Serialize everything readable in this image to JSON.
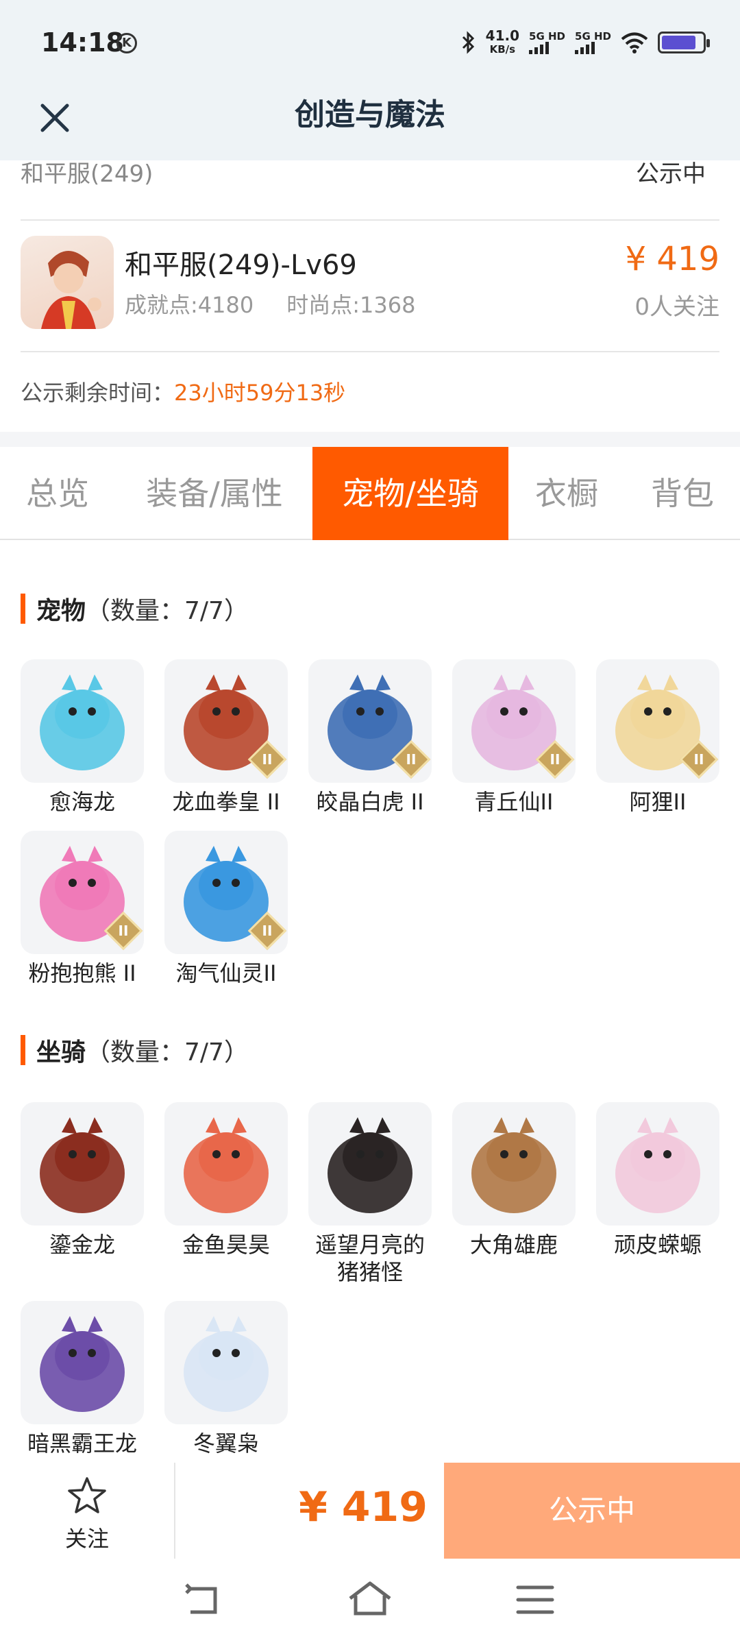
{
  "status_bar": {
    "time": "14:18",
    "k_badge": "K",
    "net_speed_value": "41.0",
    "net_speed_unit": "KB/s",
    "signal1_label": "5G HD",
    "signal2_label": "5G HD"
  },
  "nav": {
    "close_icon": "close-icon",
    "title": "创造与魔法"
  },
  "header_cut": {
    "left": "和平服(249)",
    "right": "公示中"
  },
  "character": {
    "name": "和平服(249)-Lv69",
    "achievement": "成就点:4180",
    "fashion": "时尚点:1368",
    "price": "¥ 419",
    "watchers": "0人关注"
  },
  "countdown": {
    "label": "公示剩余时间：",
    "value": "23小时59分13秒"
  },
  "tabs": [
    "总览",
    "装备/属性",
    "宠物/坐骑",
    "衣橱",
    "背包"
  ],
  "active_tab": 2,
  "pets": {
    "title": "宠物",
    "count": "（数量：7/7）",
    "badge_text": "II",
    "items": [
      {
        "name": "愈海龙",
        "color": "#59c8e6",
        "badge": false
      },
      {
        "name": "龙血拳皇 II",
        "color": "#b9482e",
        "badge": true
      },
      {
        "name": "皎晶白虎 II",
        "color": "#3f6fb5",
        "badge": true
      },
      {
        "name": "青丘仙II",
        "color": "#e6b8e0",
        "badge": true
      },
      {
        "name": "阿狸II",
        "color": "#f1d79a",
        "badge": true
      },
      {
        "name": "粉抱抱熊 II",
        "color": "#f07ab8",
        "badge": true
      },
      {
        "name": "淘气仙灵II",
        "color": "#3a98e0",
        "badge": true
      }
    ]
  },
  "mounts": {
    "title": "坐骑",
    "count": "（数量：7/7）",
    "items": [
      {
        "name": "鎏金龙",
        "color": "#8b2d1f",
        "badge": false
      },
      {
        "name": "金鱼昊昊",
        "color": "#e8674a",
        "badge": false
      },
      {
        "name": "遥望月亮的猪猪怪",
        "color": "#2a2424",
        "badge": false
      },
      {
        "name": "大角雄鹿",
        "color": "#b07846",
        "badge": false
      },
      {
        "name": "顽皮蝾螈",
        "color": "#f2c9dc",
        "badge": false
      },
      {
        "name": "暗黑霸王龙",
        "color": "#6c4da8",
        "badge": false
      },
      {
        "name": "冬翼枭",
        "color": "#d9e6f5",
        "badge": false
      }
    ]
  },
  "bottom": {
    "star_icon": "star-icon",
    "watch_label": "关注",
    "price": "¥ 419",
    "public_button": "公示中"
  },
  "colors": {
    "accent": "#ff5a00",
    "price": "#f06a14",
    "public_button_bg": "#ffa97a"
  }
}
